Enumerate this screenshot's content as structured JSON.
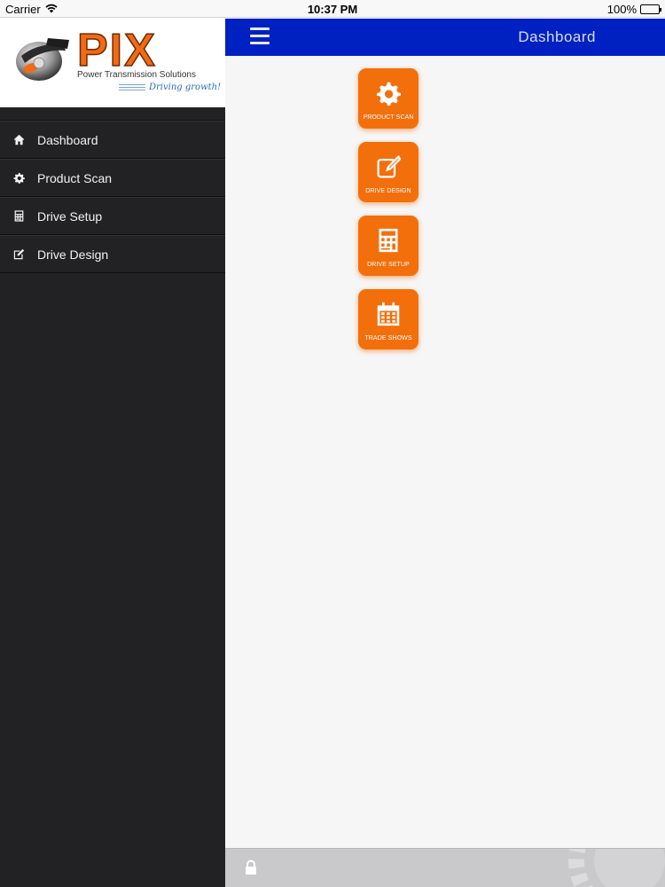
{
  "status_bar": {
    "carrier": "Carrier",
    "time": "10:37 PM",
    "battery": "100%",
    "battery_level": 1.0
  },
  "logo": {
    "brand": "PIX",
    "tagline": "Power Transmission Solutions",
    "slogan": "Driving growth!"
  },
  "sidebar": {
    "items": [
      {
        "label": "Dashboard",
        "icon": "home-icon"
      },
      {
        "label": "Product Scan",
        "icon": "gear-icon"
      },
      {
        "label": "Drive Setup",
        "icon": "calculator-icon"
      },
      {
        "label": "Drive Design",
        "icon": "edit-icon"
      }
    ]
  },
  "header": {
    "title": "Dashboard",
    "color": "#0021c2"
  },
  "tiles": [
    {
      "label": "PRODUCT SCAN",
      "icon": "gear-icon"
    },
    {
      "label": "DRIVE DESIGN",
      "icon": "edit-icon"
    },
    {
      "label": "DRIVE SETUP",
      "icon": "calculator-icon"
    },
    {
      "label": "TRADE SHOWS",
      "icon": "calendar-icon"
    }
  ],
  "colors": {
    "accent": "#f36f0c",
    "sidebar_bg": "#222224"
  },
  "footer": {
    "icon": "lock-icon"
  }
}
